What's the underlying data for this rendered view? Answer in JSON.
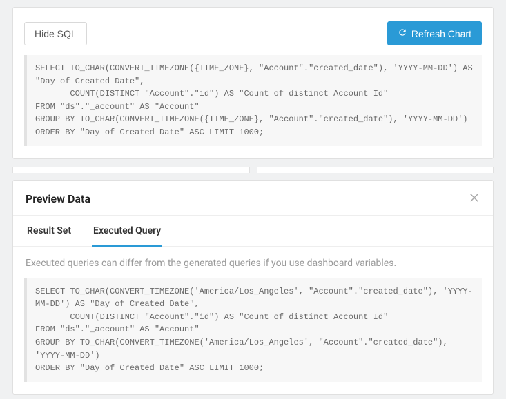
{
  "toolbar": {
    "hide_sql_label": "Hide SQL",
    "refresh_label": "Refresh Chart"
  },
  "sql_generated": "SELECT TO_CHAR(CONVERT_TIMEZONE({TIME_ZONE}, \"Account\".\"created_date\"), 'YYYY-MM-DD') AS \"Day of Created Date\",\n       COUNT(DISTINCT \"Account\".\"id\") AS \"Count of distinct Account Id\"\nFROM \"ds\".\"_account\" AS \"Account\"\nGROUP BY TO_CHAR(CONVERT_TIMEZONE({TIME_ZONE}, \"Account\".\"created_date\"), 'YYYY-MM-DD')\nORDER BY \"Day of Created Date\" ASC LIMIT 1000;",
  "preview": {
    "title": "Preview Data",
    "tabs": {
      "result_set": "Result Set",
      "executed_query": "Executed Query"
    },
    "hint": "Executed queries can differ from the generated queries if you use dashboard variables.",
    "sql_executed": "SELECT TO_CHAR(CONVERT_TIMEZONE('America/Los_Angeles', \"Account\".\"created_date\"), 'YYYY-MM-DD') AS \"Day of Created Date\",\n       COUNT(DISTINCT \"Account\".\"id\") AS \"Count of distinct Account Id\"\nFROM \"ds\".\"_account\" AS \"Account\"\nGROUP BY TO_CHAR(CONVERT_TIMEZONE('America/Los_Angeles', \"Account\".\"created_date\"), 'YYYY-MM-DD')\nORDER BY \"Day of Created Date\" ASC LIMIT 1000;"
  }
}
